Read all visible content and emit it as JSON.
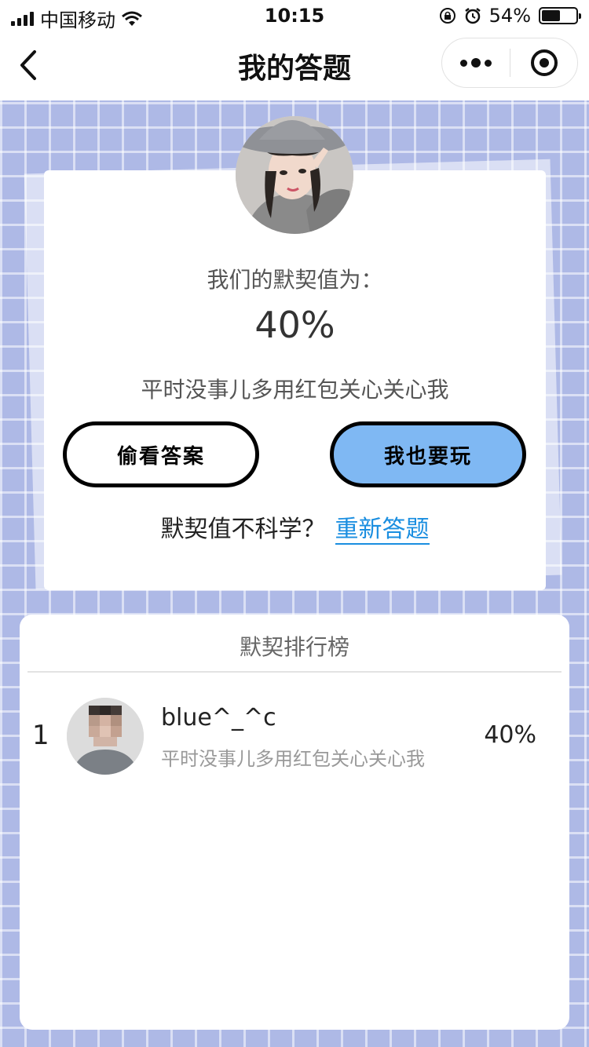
{
  "status_bar": {
    "carrier": "中国移动",
    "time": "10:15",
    "battery_percent": "54%",
    "battery_level": 0.54,
    "icons": [
      "signal-icon",
      "wifi-icon",
      "rotation-lock-icon",
      "alarm-icon",
      "battery-icon"
    ]
  },
  "nav": {
    "title": "我的答题",
    "back_icon": "chevron-left-icon",
    "more_icon": "more-dots-icon",
    "close_icon": "target-icon"
  },
  "result": {
    "match_label": "我们的默契值为：",
    "match_value": "40%",
    "comment": "平时没事儿多用红包关心关心我",
    "peek_button": "偷看答案",
    "play_button": "我也要玩",
    "redo_prompt": "默契值不科学？",
    "redo_link": "重新答题"
  },
  "ranking": {
    "title": "默契排行榜",
    "rows": [
      {
        "rank": "1",
        "name": "blue^_^c",
        "comment": "平时没事儿多用红包关心关心我",
        "score": "40%"
      }
    ]
  },
  "colors": {
    "grid_background": "#aeb9e6",
    "play_button": "#7fb8f3",
    "link": "#1a8ee0"
  }
}
